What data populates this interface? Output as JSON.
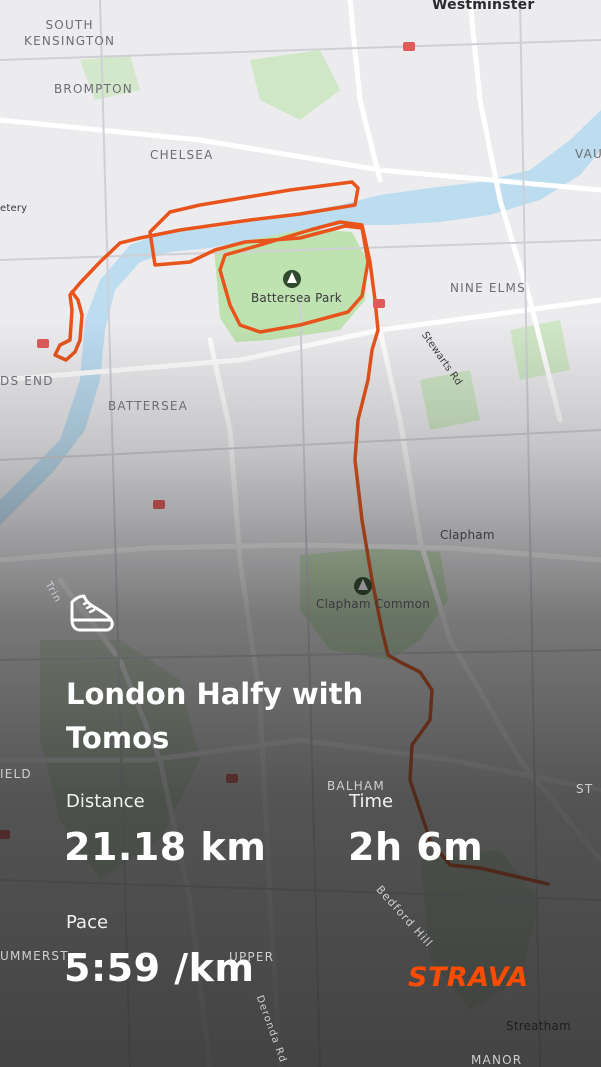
{
  "activity": {
    "title": "London Halfy with Tomos",
    "stats": {
      "distance_label": "Distance",
      "distance_value": "21.18 km",
      "time_label": "Time",
      "time_value": "2h 6m",
      "pace_label": "Pace",
      "pace_value": "5:59 /km"
    },
    "activity_icon": "running-shoe-icon"
  },
  "brand": {
    "name": "STRAVA",
    "color": "#fc4c02"
  },
  "map": {
    "route_color": "#e8541c",
    "park_color": "#bfe3b0",
    "water_color": "#bcdcf0",
    "labels": {
      "westminster": "Westminster",
      "south_kensington": "SOUTH\nKENSINGTON",
      "brompton": "BROMPTON",
      "chelsea": "CHELSEA",
      "cemetery": "etery",
      "vauxhall": "VAU",
      "nine_elms": "NINE ELMS",
      "battersea_park": "Battersea Park",
      "sands_end": "DS END",
      "battersea": "BATTERSEA",
      "stewarts_rd": "Stewarts Rd",
      "clapham": "Clapham",
      "clapham_common": "Clapham Common",
      "trinity": "Trin",
      "balham": "BALHAM",
      "field": "IELD",
      "st": "ST",
      "bedford_hill": "Bedford Hill",
      "summerstown": "UMMERST",
      "upper": "UPPER",
      "deronda_rd": "Deronda Rd",
      "streatham": "Streatham",
      "manor": "MANOR"
    },
    "icons": [
      "tree-icon",
      "rail-station-icon"
    ]
  }
}
